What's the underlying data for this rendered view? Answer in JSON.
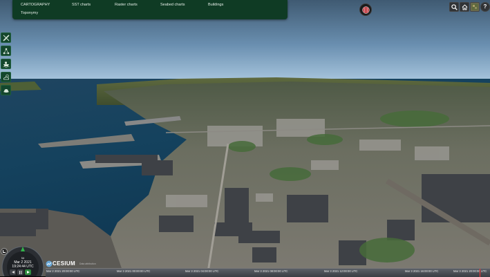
{
  "menu": {
    "items": [
      "CARTOGRAPHY",
      "SST charts",
      "Raster charts",
      "Seabed charts",
      "Buildings"
    ],
    "second_row": [
      "Toponymy"
    ]
  },
  "toolbar": {
    "icons": [
      "search-icon",
      "home-icon",
      "layers-icon",
      "help-icon"
    ],
    "help_label": "?"
  },
  "tools": [
    "ruler-icon",
    "network-icon",
    "ship-icon",
    "weather-icon",
    "hat-icon"
  ],
  "animation": {
    "multiplier": "1x",
    "date": "Mar 2 2021",
    "time": "19:24:44 UTC"
  },
  "credit": {
    "logo_text": "CESIUM",
    "attribution": "Data attribution"
  },
  "timeline": {
    "ticks": [
      "Mar 2 2021 20:00:00 UTC",
      "Mar 3 2021 00:00:00 UTC",
      "Mar 3 2021 04:00:00 UTC",
      "Mar 3 2021 08:00:00 UTC",
      "Mar 3 2021 12:00:00 UTC",
      "Mar 3 2021 16:00:00 UTC",
      "Mar 3 2021 20:00:00 UTC"
    ]
  },
  "colors": {
    "menu_bg": "#0f3b24",
    "tool_bg": "#14462d",
    "globe_icon": "#c0222a"
  }
}
